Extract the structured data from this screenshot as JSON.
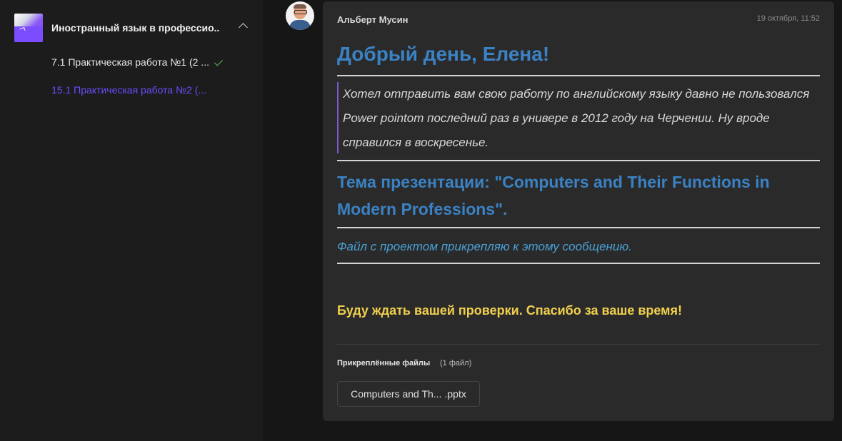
{
  "sidebar": {
    "course_title": "Иностранный язык в профессио...",
    "items": [
      {
        "label": "7.1 Практическая работа №1 (2 ..."
      },
      {
        "label": "15.1 Практическая работа №2 (..."
      }
    ],
    "accent_color": "#6a4cff",
    "check_color": "#5fb85f"
  },
  "message": {
    "author": "Альберт Мусин",
    "timestamp": "19 октября, 11:52",
    "greeting": "Добрый день, Елена!",
    "quote": "Хотел отправить вам свою работу по английскому языку давно не пользовался Power pointom последний раз в универе в 2012 году на Черчении. Ну вроде справился в воскресенье.",
    "topic": "Тема презентации: \"Computers and Their Functions in Modern Professions\".",
    "file_note": "Файл с проектом прикрепляю к этому сообщению.",
    "closing": "Буду ждать вашей проверки. Спасибо за ваше время!",
    "attachments": {
      "label": "Прикреплённые файлы",
      "count_text": "(1 файл)",
      "files": [
        {
          "name": "Computers and Th...",
          "ext": ".pptx"
        }
      ]
    },
    "colors": {
      "heading_blue": "#3b82c4",
      "note_blue": "#4a9fd5",
      "closing_yellow": "#f1d04d"
    }
  }
}
